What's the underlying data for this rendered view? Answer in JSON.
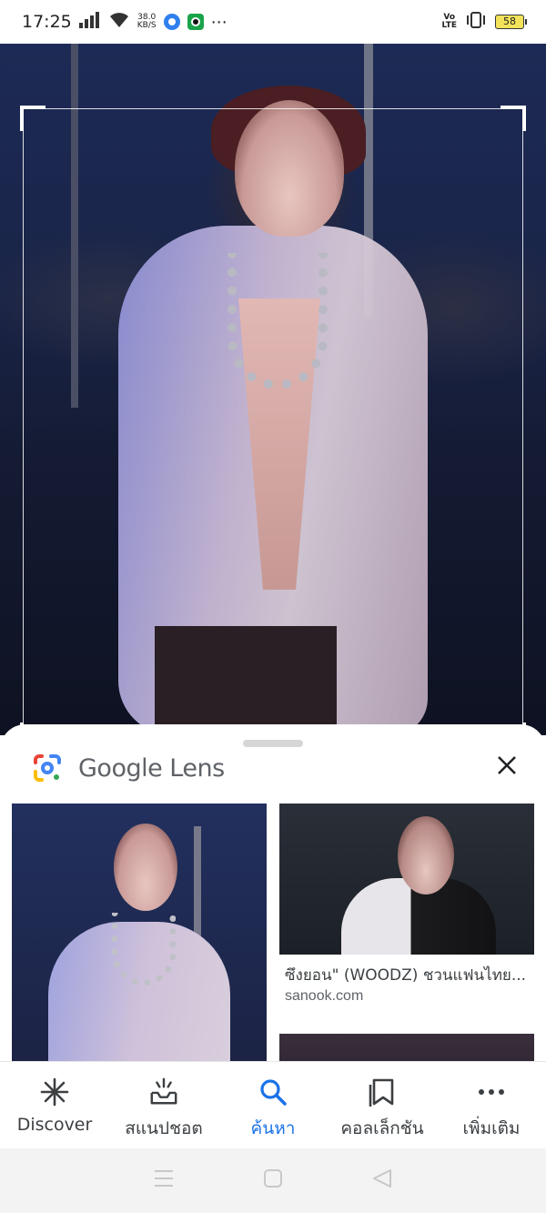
{
  "status_bar": {
    "time": "17:25",
    "speed_value": "38.0",
    "speed_unit": "KB/S",
    "volte_top": "Vo",
    "volte_bottom": "LTE",
    "battery": "58"
  },
  "lens": {
    "title": "Google Lens",
    "logo_colors": [
      "#ea4335",
      "#fbbc04",
      "#34a853",
      "#4285f4"
    ]
  },
  "results": [
    {
      "caption": "",
      "source": ""
    },
    {
      "caption": "ซึงยอน\" (WOODZ) ชวนแฟนไทย...",
      "source": "sanook.com"
    }
  ],
  "bottom_nav": {
    "items": [
      {
        "label": "Discover",
        "icon": "asterisk-icon",
        "active": false
      },
      {
        "label": "สแนปชอต",
        "icon": "snapshot-tray-icon",
        "active": false
      },
      {
        "label": "ค้นหา",
        "icon": "search-icon",
        "active": true
      },
      {
        "label": "คอลเล็กชัน",
        "icon": "collections-bookmark-icon",
        "active": false
      },
      {
        "label": "เพิ่มเติม",
        "icon": "more-dots-icon",
        "active": false
      }
    ],
    "accent_color": "#1a73e8"
  },
  "system_nav": {
    "items": [
      "menu-lines-icon",
      "home-square-icon",
      "back-triangle-icon"
    ]
  }
}
